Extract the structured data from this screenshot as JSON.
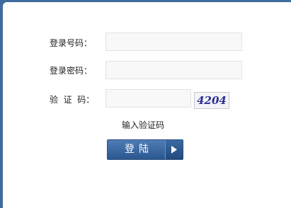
{
  "form": {
    "account_label": "登录号码：",
    "account_value": "",
    "password_label": "登录密码：",
    "password_value": "",
    "captcha_label": "验  证  码：",
    "captcha_value": "",
    "captcha_image_text": "4204",
    "captcha_hint": "输入验证码",
    "login_label": "登陆"
  },
  "icons": {
    "login_arrow": "play-arrow-icon"
  },
  "colors": {
    "background": "#3f6d9f",
    "button": "#3a6aa4",
    "captcha_text": "#2c2c92"
  }
}
